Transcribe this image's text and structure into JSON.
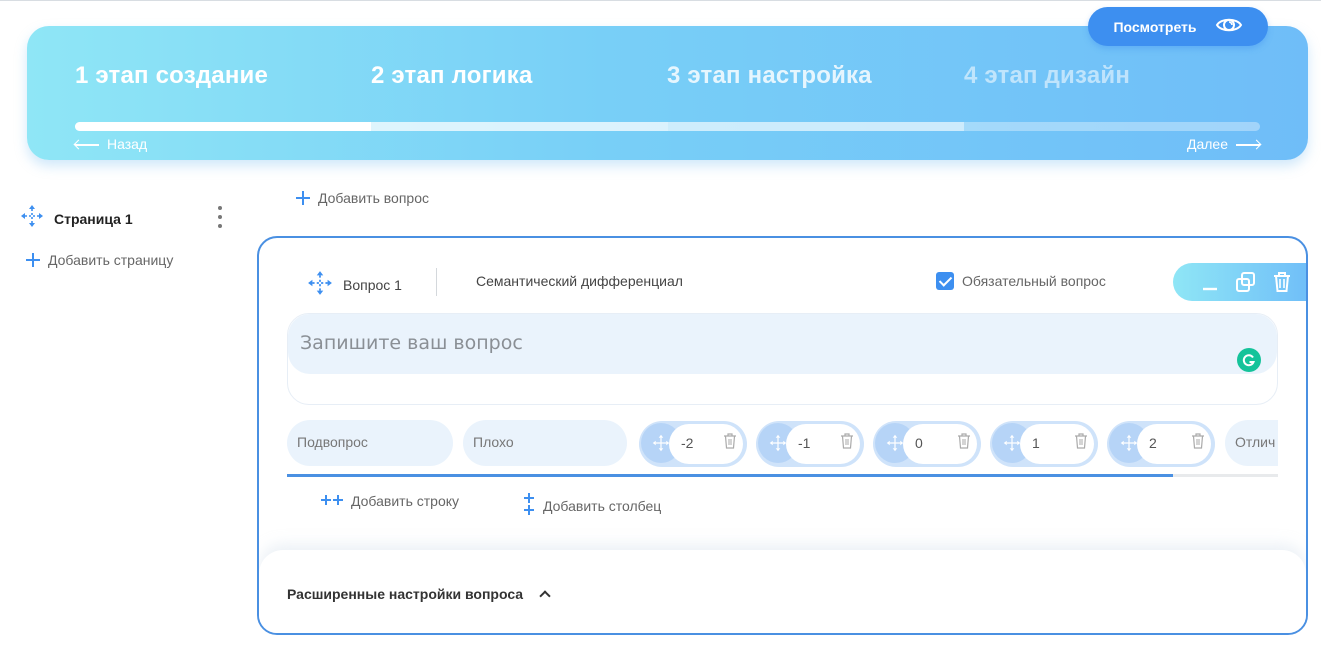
{
  "header": {
    "stages": [
      "1 этап создание",
      "2 этап логика",
      "3 этап настройка",
      "4 этап дизайн"
    ],
    "back_label": "Назад",
    "next_label": "Далее",
    "view_button_label": "Посмотреть",
    "current_stage": 1,
    "progress_percent": 25
  },
  "sidebar": {
    "page_label": "Страница 1",
    "add_page_label": "Добавить страницу"
  },
  "editor": {
    "add_question_label": "Добавить вопрос",
    "question": {
      "number_label": "Вопрос 1",
      "type_label": "Семантический дифференциал",
      "required_label": "Обязательный вопрос",
      "required_checked": true,
      "text_placeholder": "Запишите ваш вопрос",
      "subquestion_placeholder": "Подвопрос",
      "left_label": "Плохо",
      "scale_values": [
        "-2",
        "-1",
        "0",
        "1",
        "2"
      ],
      "right_label": "Отлич",
      "add_row_label": "Добавить строку",
      "add_column_label": "Добавить столбец",
      "advanced_label": "Расширенные настройки вопроса"
    }
  },
  "colors": {
    "accent": "#3d8ff0",
    "card_border": "#4a90e2",
    "input_bg": "#eaf3fc",
    "grammarly": "#15c39a"
  },
  "icons": [
    "eye-icon",
    "move-icon",
    "kebab-icon",
    "plus-icon",
    "minimize-icon",
    "copy-icon",
    "trash-icon",
    "grammarly-icon",
    "chevron-up-icon",
    "add-row-icon",
    "add-column-icon"
  ]
}
